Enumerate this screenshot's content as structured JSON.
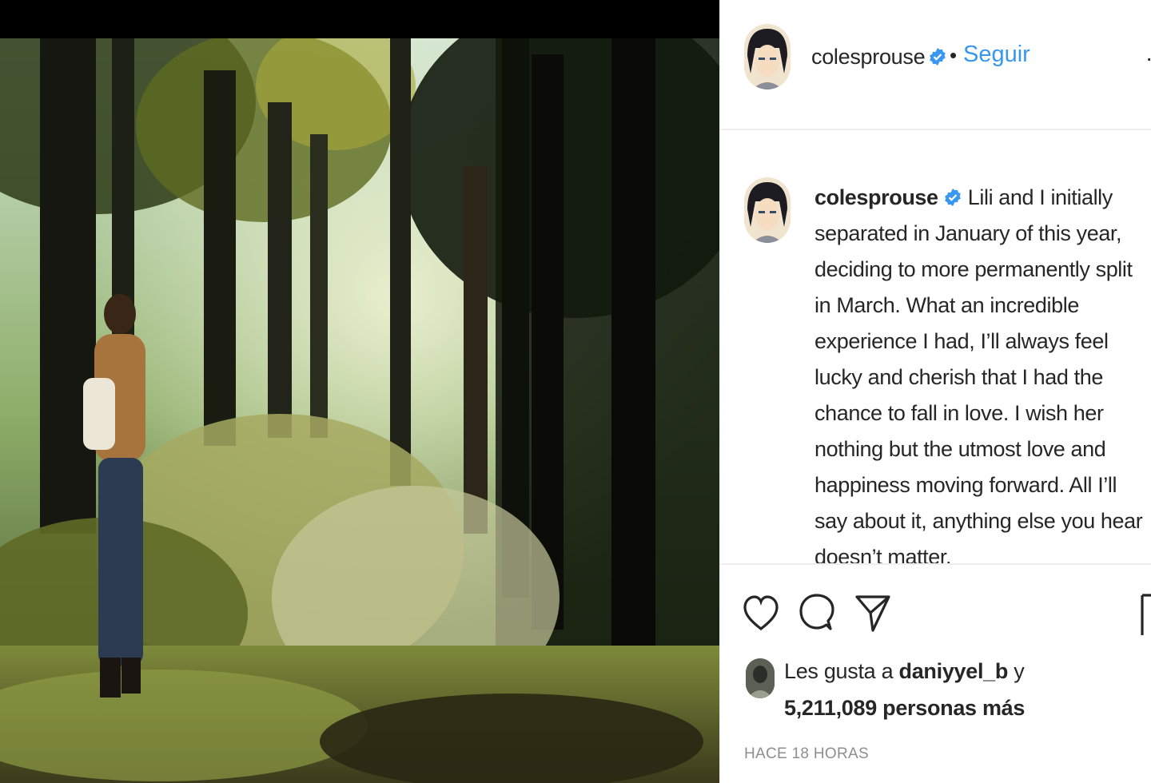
{
  "post": {
    "username": "colesprouse",
    "follow_label": "Seguir",
    "separator": "•",
    "caption": "Lili and I initially separated in January of this year, deciding to more permanently split in March. What an incredible experience I had, I’ll always feel lucky and cherish that I had the chance to fall in love. I wish her nothing but the utmost love and happiness moving forward. All I’ll say about it, anything else you hear doesn’t matter.",
    "likes_prefix": "Les gusta a ",
    "likes_user": "daniyyel_b",
    "likes_conjunction": " y",
    "likes_count_text": "5,211,089 personas más",
    "timestamp": "HACE 18 HORAS"
  },
  "icons": {
    "verified": "verified-badge-icon",
    "like": "heart-icon",
    "comment": "comment-icon",
    "share": "paper-plane-icon",
    "save": "bookmark-icon",
    "more": "more-options-icon"
  },
  "colors": {
    "link_blue": "#3897f0",
    "verified_blue": "#3897f0",
    "text": "#262626",
    "muted": "#8e8e8e",
    "divider": "#efefef"
  }
}
